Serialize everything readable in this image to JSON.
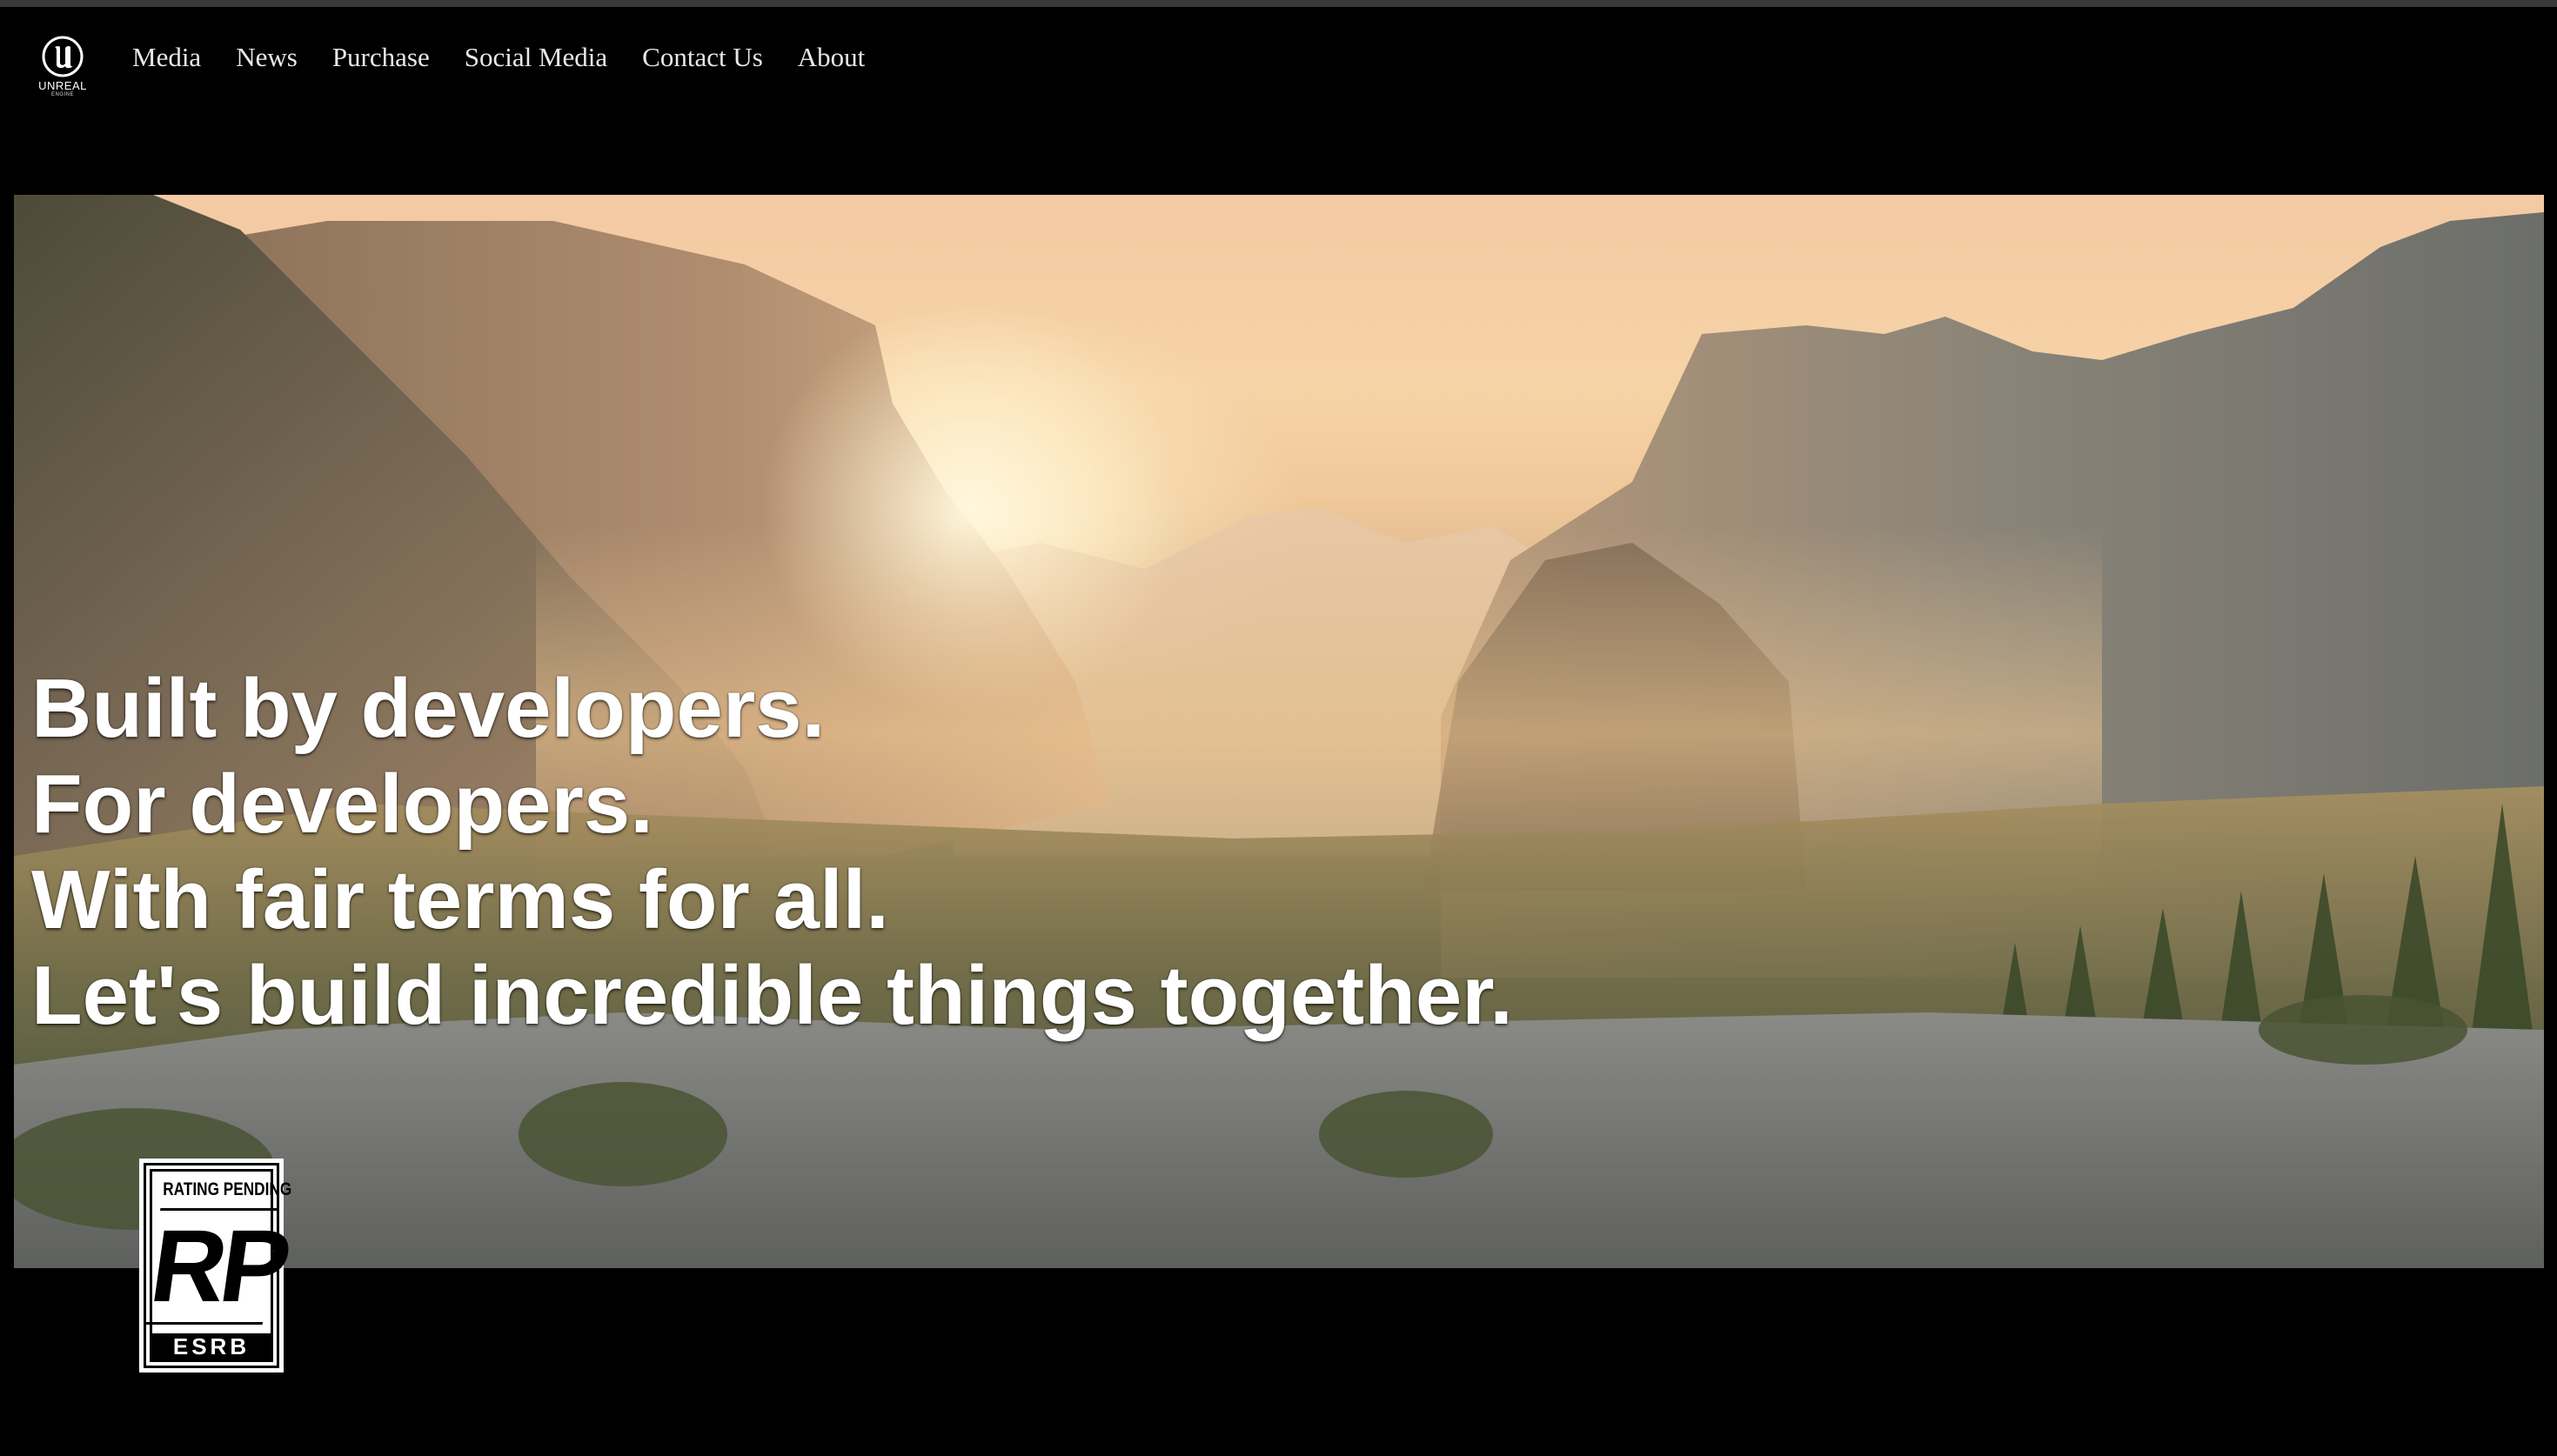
{
  "header": {
    "logo": {
      "icon": "unreal-engine-logo-icon",
      "text": "UNREAL",
      "subtext": "ENGINE"
    },
    "nav": [
      {
        "label": "Media"
      },
      {
        "label": "News"
      },
      {
        "label": "Purchase"
      },
      {
        "label": "Social Media"
      },
      {
        "label": "Contact Us"
      },
      {
        "label": "About"
      }
    ]
  },
  "hero": {
    "background": "valley-landscape-image",
    "headline_lines": [
      "Built by developers.",
      "For developers.",
      "With fair terms for all.",
      "Let's build incredible things together."
    ]
  },
  "esrb_badge": {
    "top_text": "RATING PENDING",
    "rating": "RP",
    "bottom_text": "ESRB"
  },
  "colors": {
    "page_background": "#000000",
    "nav_text": "#e8e8e8",
    "headline_text": "#ffffff"
  }
}
